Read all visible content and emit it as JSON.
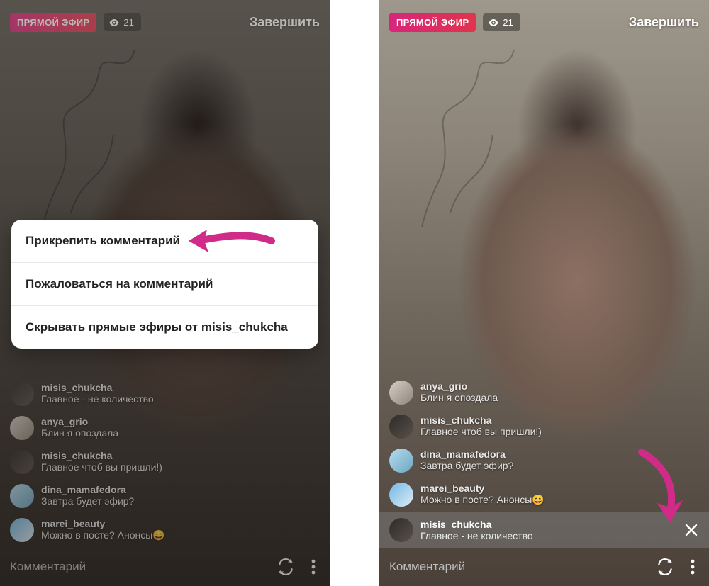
{
  "badges": {
    "live_label": "ПРЯМОЙ ЭФИР",
    "viewer_count": "21",
    "end_label": "Завершить"
  },
  "action_sheet": {
    "pin": "Прикрепить комментарий",
    "report": "Пожаловаться на комментарий",
    "hide": "Скрывать прямые эфиры от misis_chukcha"
  },
  "left_comments": [
    {
      "user": "misis_chukcha",
      "text": "Главное - не количество"
    },
    {
      "user": "anya_grio",
      "text": "Блин я опоздала"
    },
    {
      "user": "misis_chukcha",
      "text": "Главное чтоб вы пришли!)"
    },
    {
      "user": "dina_mamafedora",
      "text": "Завтра будет эфир?"
    },
    {
      "user": "marei_beauty",
      "text": "Можно в посте? Анонсы😄"
    }
  ],
  "right_comments": [
    {
      "user": "anya_grio",
      "text": "Блин я опоздала"
    },
    {
      "user": "misis_chukcha",
      "text": "Главное чтоб вы пришли!)"
    },
    {
      "user": "dina_mamafedora",
      "text": "Завтра будет эфир?"
    },
    {
      "user": "marei_beauty",
      "text": "Можно в посте? Анонсы😄"
    }
  ],
  "pinned": {
    "user": "misis_chukcha",
    "text": "Главное - не количество"
  },
  "input_placeholder": "Комментарий",
  "avatar_colors": {
    "misis_chukcha": "linear-gradient(135deg,#2b2b2b,#5b5048)",
    "anya_grio": "linear-gradient(135deg,#d6cfc6,#8e857a)",
    "dina_mamafedora": "linear-gradient(135deg,#b6dcee,#6da6c2)",
    "marei_beauty": "linear-gradient(135deg,#6fb7e6,#e0ecf4)"
  }
}
